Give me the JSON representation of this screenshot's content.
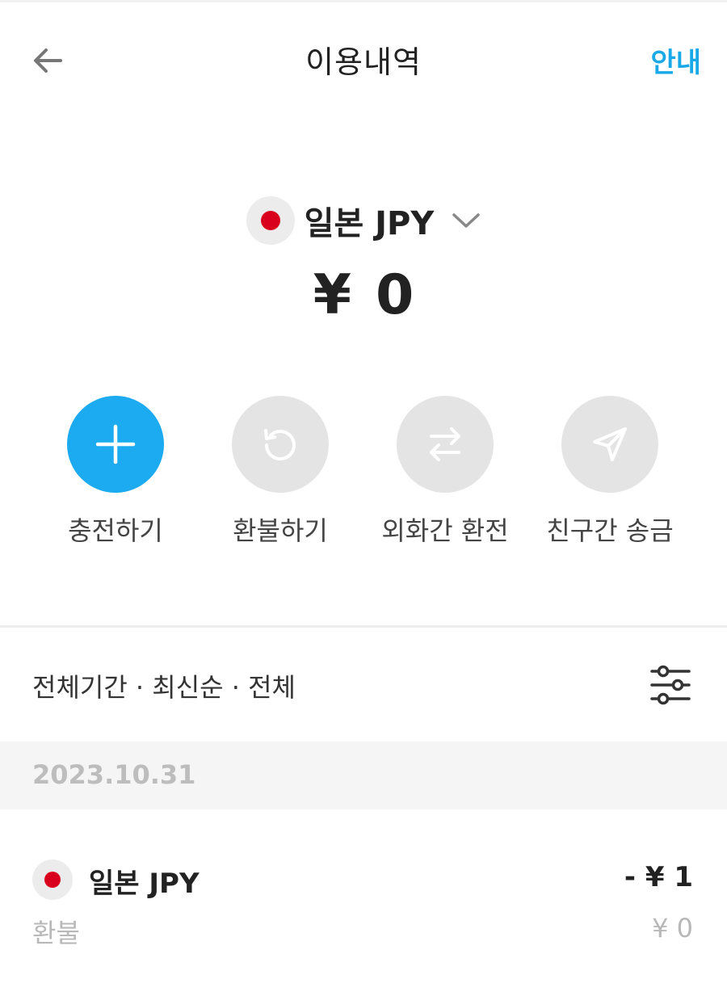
{
  "header": {
    "title": "이용내역",
    "guide_label": "안내"
  },
  "wallet": {
    "currency_label": "일본 JPY",
    "balance_symbol": "¥",
    "balance_value": "0"
  },
  "actions": [
    {
      "label": "충전하기",
      "icon": "plus-icon"
    },
    {
      "label": "환불하기",
      "icon": "refund-icon"
    },
    {
      "label": "외화간 환전",
      "icon": "exchange-icon"
    },
    {
      "label": "친구간 송금",
      "icon": "send-icon"
    }
  ],
  "filter": {
    "summary": "전체기간 · 최신순 · 전체"
  },
  "transactions": {
    "date": "2023.10.31",
    "items": [
      {
        "currency": "일본 JPY",
        "amount": "- ¥ 1",
        "type": "환불",
        "balance_after": "¥ 0"
      }
    ]
  },
  "colors": {
    "accent": "#1caaf0",
    "link": "#19a9e8",
    "japan_flag_red": "#d8001c",
    "disabled_circle": "#e4e4e4"
  }
}
